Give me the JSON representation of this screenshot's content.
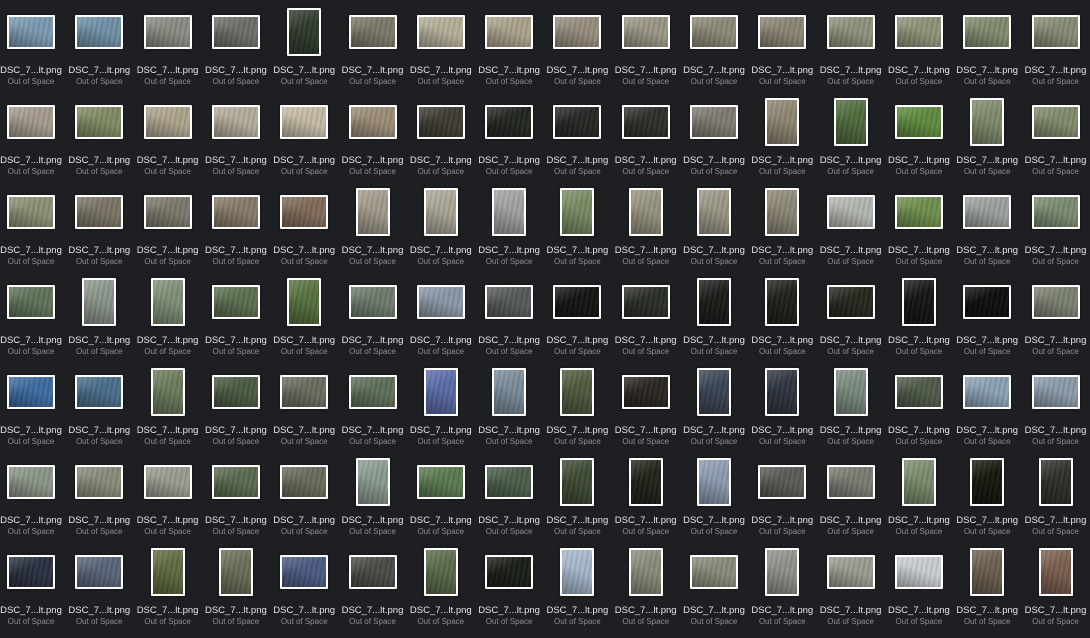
{
  "file_label": "DSC_7...lt.png",
  "status_label": "Out of Space",
  "rows": [
    [
      {
        "o": "l",
        "c": "#7a98b0"
      },
      {
        "o": "l",
        "c": "#6f8fa6"
      },
      {
        "o": "l",
        "c": "#8a8a82"
      },
      {
        "o": "l",
        "c": "#6d6e68"
      },
      {
        "o": "p",
        "c": "#2f3a2c"
      },
      {
        "o": "l",
        "c": "#7b7868"
      },
      {
        "o": "l",
        "c": "#b4ad98"
      },
      {
        "o": "l",
        "c": "#a9a18c"
      },
      {
        "o": "l",
        "c": "#958c7d"
      },
      {
        "o": "l",
        "c": "#9a9584"
      },
      {
        "o": "l",
        "c": "#8d8876"
      },
      {
        "o": "l",
        "c": "#8a8474"
      },
      {
        "o": "l",
        "c": "#8c927a"
      },
      {
        "o": "l",
        "c": "#8d9378"
      },
      {
        "o": "l",
        "c": "#7f8a6e"
      },
      {
        "o": "l",
        "c": "#858c73"
      }
    ],
    [
      {
        "o": "l",
        "c": "#a49a8c"
      },
      {
        "o": "l",
        "c": "#7f8a62"
      },
      {
        "o": "l",
        "c": "#aca38c"
      },
      {
        "o": "l",
        "c": "#b2ab9a"
      },
      {
        "o": "l",
        "c": "#c4baa4"
      },
      {
        "o": "l",
        "c": "#9a8b76"
      },
      {
        "o": "l",
        "c": "#3e3c32"
      },
      {
        "o": "l",
        "c": "#222620"
      },
      {
        "o": "l",
        "c": "#262824"
      },
      {
        "o": "l",
        "c": "#2e2f2a"
      },
      {
        "o": "l",
        "c": "#7e7a72"
      },
      {
        "o": "p",
        "c": "#8e8470"
      },
      {
        "o": "p",
        "c": "#4f6a3c"
      },
      {
        "o": "l",
        "c": "#5f8a3e"
      },
      {
        "o": "p",
        "c": "#7e8a6a"
      },
      {
        "o": "l",
        "c": "#7f8a6a"
      }
    ],
    [
      {
        "o": "l",
        "c": "#8a8f74"
      },
      {
        "o": "l",
        "c": "#7a7466"
      },
      {
        "o": "l",
        "c": "#7c776a"
      },
      {
        "o": "l",
        "c": "#867a68"
      },
      {
        "o": "l",
        "c": "#7e6a58"
      },
      {
        "o": "p",
        "c": "#a09a8a"
      },
      {
        "o": "p",
        "c": "#aaa596"
      },
      {
        "o": "p",
        "c": "#9fa0a0"
      },
      {
        "o": "p",
        "c": "#788a62"
      },
      {
        "o": "p",
        "c": "#96927e"
      },
      {
        "o": "p",
        "c": "#9a9684"
      },
      {
        "o": "p",
        "c": "#8c8674"
      },
      {
        "o": "l",
        "c": "#b2b6b0"
      },
      {
        "o": "l",
        "c": "#6e8e4c"
      },
      {
        "o": "l",
        "c": "#9aa09c"
      },
      {
        "o": "l",
        "c": "#7a8a70"
      }
    ],
    [
      {
        "o": "l",
        "c": "#5e7258"
      },
      {
        "o": "p",
        "c": "#8a958a"
      },
      {
        "o": "p",
        "c": "#7f8e76"
      },
      {
        "o": "l",
        "c": "#5c6e4e"
      },
      {
        "o": "p",
        "c": "#56703e"
      },
      {
        "o": "l",
        "c": "#6c7a6c"
      },
      {
        "o": "l",
        "c": "#8a96a6"
      },
      {
        "o": "l",
        "c": "#565a5a"
      },
      {
        "o": "l",
        "c": "#141412"
      },
      {
        "o": "l",
        "c": "#2a2e28"
      },
      {
        "o": "p",
        "c": "#1a1c18"
      },
      {
        "o": "p",
        "c": "#1e2018"
      },
      {
        "o": "l",
        "c": "#24281e"
      },
      {
        "o": "p",
        "c": "#141414"
      },
      {
        "o": "l",
        "c": "#0e0e10"
      },
      {
        "o": "l",
        "c": "#7a8070"
      }
    ],
    [
      {
        "o": "l",
        "c": "#3c6aa0"
      },
      {
        "o": "l",
        "c": "#4a6c8a"
      },
      {
        "o": "p",
        "c": "#6a7a5a"
      },
      {
        "o": "l",
        "c": "#4a5a42"
      },
      {
        "o": "l",
        "c": "#6a6a5e"
      },
      {
        "o": "l",
        "c": "#5e6e58"
      },
      {
        "o": "p",
        "c": "#5a6aa8"
      },
      {
        "o": "p",
        "c": "#7a8a9a"
      },
      {
        "o": "p",
        "c": "#4e5a3e"
      },
      {
        "o": "l",
        "c": "#2a2622"
      },
      {
        "o": "p",
        "c": "#3a4454"
      },
      {
        "o": "p",
        "c": "#2e3440"
      },
      {
        "o": "p",
        "c": "#7a8a7e"
      },
      {
        "o": "l",
        "c": "#4e5a48"
      },
      {
        "o": "l",
        "c": "#8aa0b4"
      },
      {
        "o": "l",
        "c": "#8a9aa8"
      }
    ],
    [
      {
        "o": "l",
        "c": "#8a9488"
      },
      {
        "o": "l",
        "c": "#8a8a7a"
      },
      {
        "o": "l",
        "c": "#9a9a90"
      },
      {
        "o": "l",
        "c": "#5a6a4e"
      },
      {
        "o": "l",
        "c": "#6a6a5a"
      },
      {
        "o": "p",
        "c": "#8a9a90"
      },
      {
        "o": "l",
        "c": "#5a7a50"
      },
      {
        "o": "l",
        "c": "#4a5e4a"
      },
      {
        "o": "p",
        "c": "#3e4a34"
      },
      {
        "o": "p",
        "c": "#1e2218"
      },
      {
        "o": "p",
        "c": "#8a9aae"
      },
      {
        "o": "l",
        "c": "#5a5a56"
      },
      {
        "o": "l",
        "c": "#7a7a72"
      },
      {
        "o": "p",
        "c": "#7a8a6a"
      },
      {
        "o": "p",
        "c": "#16160e"
      },
      {
        "o": "p",
        "c": "#2e2e2a"
      }
    ],
    [
      {
        "o": "l",
        "c": "#2a3040"
      },
      {
        "o": "l",
        "c": "#5a6478"
      },
      {
        "o": "p",
        "c": "#5e6a40"
      },
      {
        "o": "p",
        "c": "#6a6e56"
      },
      {
        "o": "l",
        "c": "#4a5a80"
      },
      {
        "o": "l",
        "c": "#4a4a46"
      },
      {
        "o": "p",
        "c": "#5a6a4a"
      },
      {
        "o": "l",
        "c": "#1a1e18"
      },
      {
        "o": "p",
        "c": "#a4b6ca"
      },
      {
        "o": "p",
        "c": "#8a8a7a"
      },
      {
        "o": "l",
        "c": "#8a8a7a"
      },
      {
        "o": "p",
        "c": "#8e9088"
      },
      {
        "o": "l",
        "c": "#9a9a90"
      },
      {
        "o": "l",
        "c": "#c8ccd0"
      },
      {
        "o": "p",
        "c": "#6a5e4e"
      },
      {
        "o": "p",
        "c": "#7a5e4e"
      }
    ]
  ]
}
